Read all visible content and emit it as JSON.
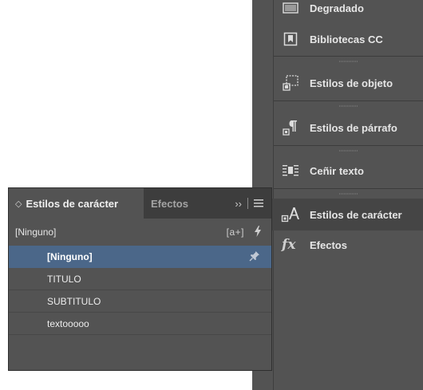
{
  "dock": {
    "items": [
      {
        "label": "Degradado",
        "icon": "gradient-icon"
      },
      {
        "label": "Bibliotecas CC",
        "icon": "cc-libraries-icon"
      },
      {
        "label": "Estilos de objeto",
        "icon": "object-styles-icon"
      },
      {
        "label": "Estilos de párrafo",
        "icon": "paragraph-styles-icon"
      },
      {
        "label": "Ceñir texto",
        "icon": "text-wrap-icon"
      },
      {
        "label": "Estilos de carácter",
        "icon": "character-styles-icon"
      },
      {
        "label": "Efectos",
        "icon": "effects-icon"
      }
    ]
  },
  "panel": {
    "active_tab": "Estilos de carácter",
    "inactive_tab": "Efectos",
    "current_style": "[Ninguno]",
    "new_style_glyph": "[a+]",
    "styles": [
      "[Ninguno]",
      "TITULO",
      "SUBTITULO",
      "textooooo"
    ],
    "selected_index": 0
  },
  "colors": {
    "panel_bg": "#535353",
    "tab_bg": "#3d3d3d",
    "selection": "#4b6789"
  }
}
